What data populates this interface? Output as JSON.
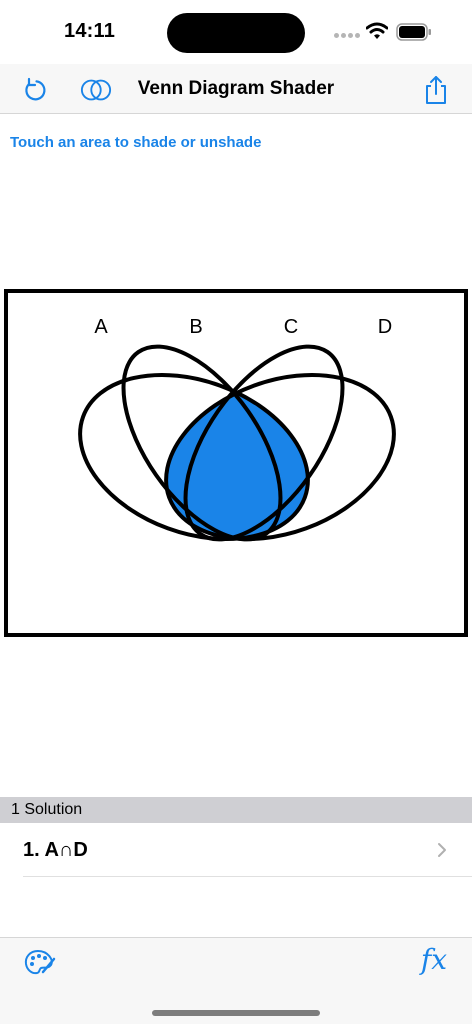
{
  "status": {
    "time": "14:11"
  },
  "nav": {
    "title": "Venn Diagram Shader"
  },
  "hint": "Touch an area to shade or unshade",
  "venn": {
    "labels": [
      "A",
      "B",
      "C",
      "D"
    ],
    "shade_color": "#1a84e8"
  },
  "solutions": {
    "header": "1 Solution",
    "items": [
      "1. A∩D"
    ]
  },
  "tabbar": {
    "fx_label": "fx"
  },
  "colors": {
    "accent": "#1a84e8"
  }
}
